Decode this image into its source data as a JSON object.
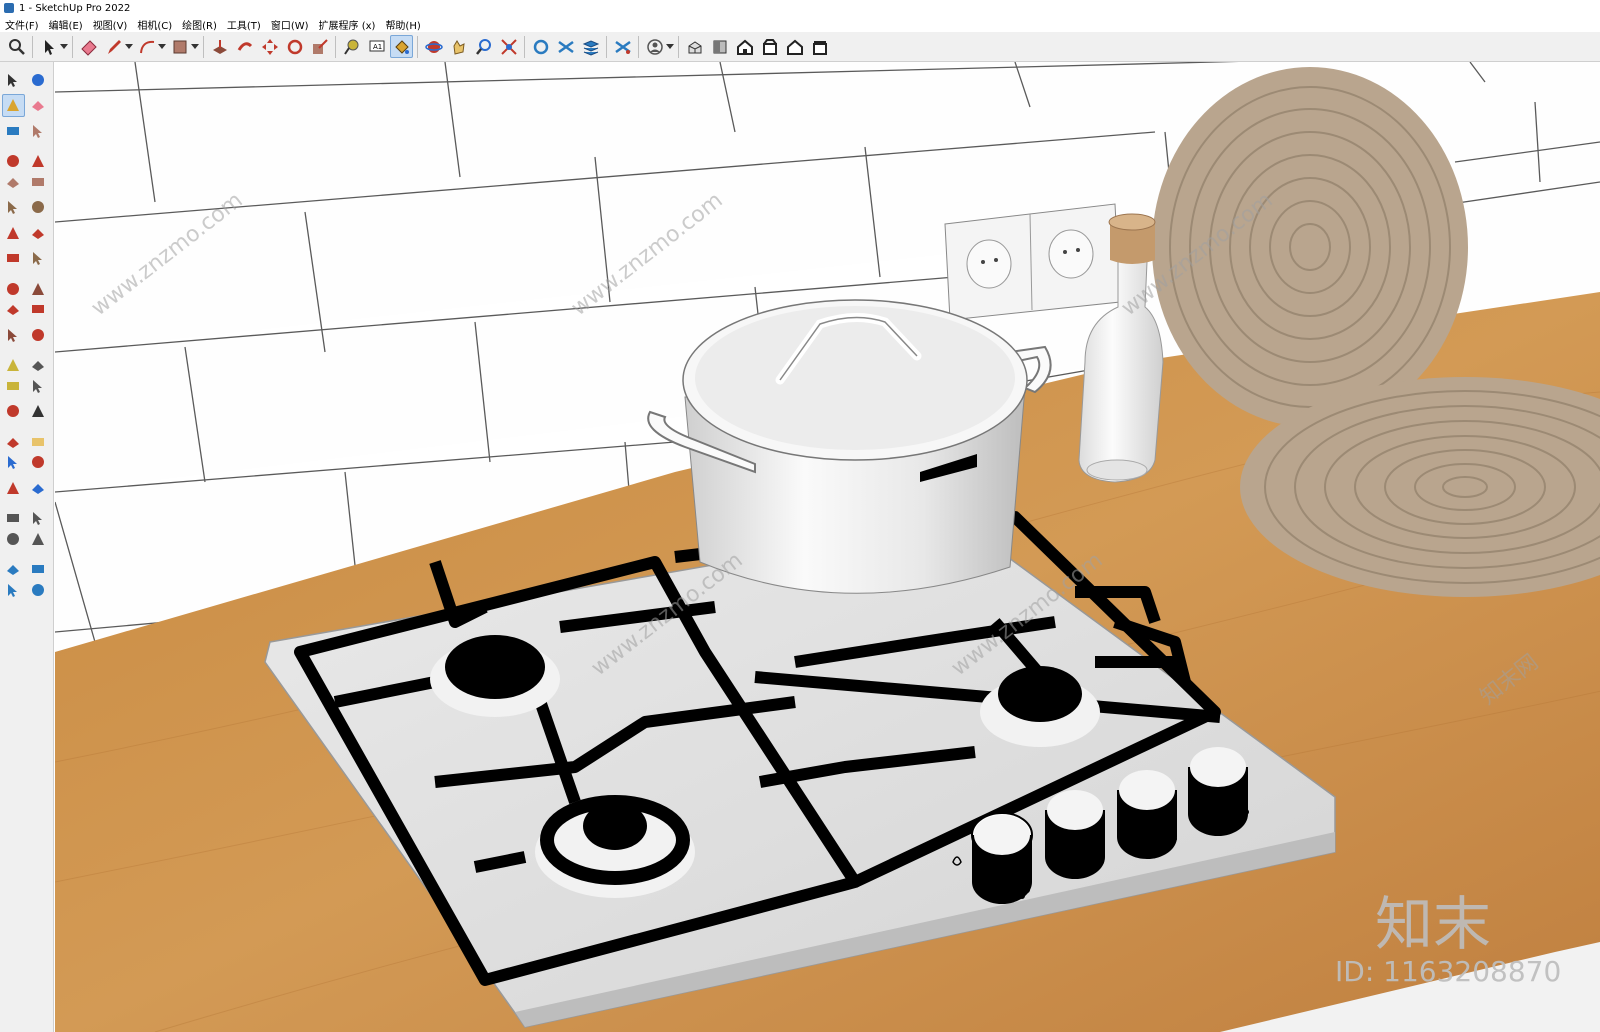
{
  "window": {
    "title": "1 - SketchUp Pro 2022"
  },
  "menu": [
    {
      "label": "文件(F)"
    },
    {
      "label": "编辑(E)"
    },
    {
      "label": "视图(V)"
    },
    {
      "label": "相机(C)"
    },
    {
      "label": "绘图(R)"
    },
    {
      "label": "工具(T)"
    },
    {
      "label": "窗口(W)"
    },
    {
      "label": "扩展程序 (x)"
    },
    {
      "label": "帮助(H)"
    }
  ],
  "toolbar": {
    "tools": [
      "zoom",
      "select",
      "select-dropdown",
      "eraser",
      "pencil",
      "pencil-dropdown",
      "arc",
      "arc-dropdown",
      "rectangle",
      "rectangle-dropdown",
      "push-pull",
      "follow-me",
      "move",
      "rotate",
      "scale",
      "tape-measure",
      "text",
      "paint-bucket",
      "orbit",
      "pan",
      "zoom-window",
      "zoom-extents",
      "warehouse",
      "extension-warehouse",
      "layout",
      "style-builder",
      "account",
      "account-dropdown",
      "views-iso",
      "views-top",
      "views-front",
      "views-right",
      "views-back",
      "views-left"
    ],
    "active_tool": "paint-bucket"
  },
  "left_toolbar": {
    "tools": [
      "select",
      "orbit",
      "paint-bucket",
      "eraser",
      "component",
      "tag",
      "line",
      "freehand",
      "rectangle",
      "rotated-rectangle",
      "circle",
      "polygon",
      "arc",
      "two-point-arc",
      "pie",
      "three-point-arc",
      "move",
      "push-pull",
      "rotate",
      "follow-me",
      "scale",
      "offset",
      "tape-measure",
      "dimension",
      "protractor",
      "text",
      "axes",
      "3d-text",
      "orbit-2",
      "pan",
      "zoom",
      "zoom-window",
      "zoom-extents",
      "previous",
      "position-camera",
      "look-around",
      "walk",
      "section-plane",
      "warehouse",
      "extension-warehouse",
      "layout",
      "style-builder"
    ],
    "active_tool": "paint-bucket"
  },
  "watermark": {
    "site": "www.znzmo.com",
    "brand": "知末网",
    "logo": "知末",
    "id": "ID: 1163208870"
  },
  "colors": {
    "countertop": "#c98c47",
    "tile": "#ffffff",
    "hob": "#e2e2e2",
    "grate": "#000000",
    "placemat": "#b9a58e",
    "cork": "#c49a6c"
  }
}
